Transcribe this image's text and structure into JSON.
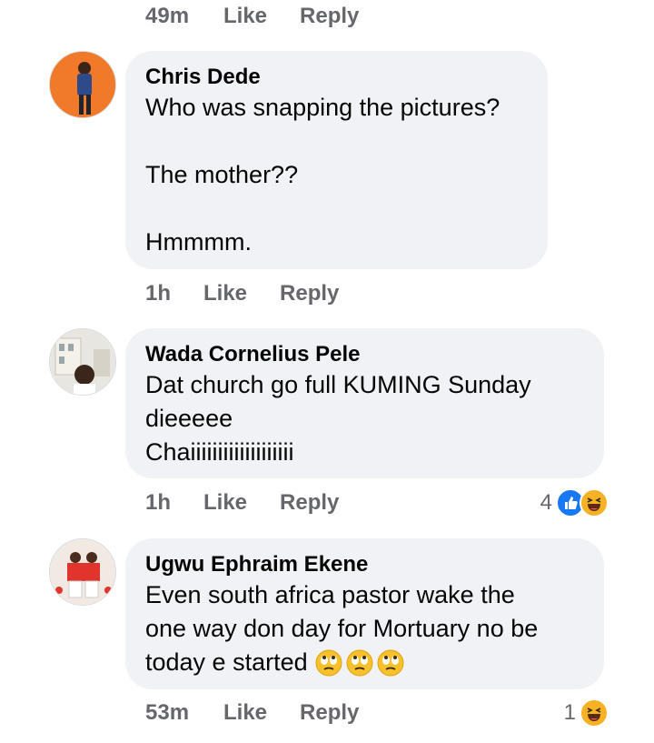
{
  "top_meta": {
    "time": "49m",
    "like": "Like",
    "reply": "Reply"
  },
  "comments": [
    {
      "author": "Chris Dede",
      "lines": [
        "Who was snapping the pictures?",
        "",
        "The mother??",
        "",
        "Hmmmm."
      ],
      "time": "1h",
      "like": "Like",
      "reply": "Reply",
      "reaction_count": "",
      "reactions": []
    },
    {
      "author": "Wada Cornelius Pele",
      "lines": [
        "Dat church go full KUMING Sunday",
        "dieeeee",
        "Chaiiiiiiiiiiiiiiiiiii"
      ],
      "time": "1h",
      "like": "Like",
      "reply": "Reply",
      "reaction_count": "4",
      "reactions": [
        "like-icon",
        "haha-icon"
      ]
    },
    {
      "author": "Ugwu Ephraim Ekene",
      "lines": [
        "Even south africa pastor wake the",
        "one way don day for Mortuary  no be",
        "today e started"
      ],
      "emoji": [
        "rolling-eyes-icon",
        "rolling-eyes-icon",
        "rolling-eyes-icon"
      ],
      "time": "53m",
      "like": "Like",
      "reply": "Reply",
      "reaction_count": "1",
      "reactions": [
        "haha-icon"
      ]
    }
  ],
  "colors": {
    "bubble": "#f0f2f5",
    "meta_text": "#65676b",
    "like_blue": "#1877f2",
    "haha_yellow": "#f7b125"
  }
}
